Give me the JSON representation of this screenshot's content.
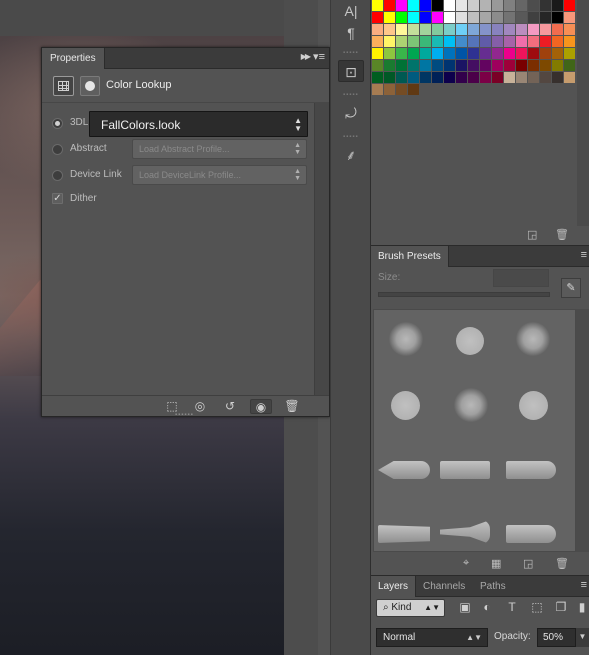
{
  "properties": {
    "tab_label": "Properties",
    "panel_title": "Color Lookup",
    "rows": [
      {
        "label": "3DLUT File",
        "value": "FallColors.look",
        "selected": true
      },
      {
        "label": "Abstract",
        "value": "Load Abstract Profile...",
        "selected": false
      },
      {
        "label": "Device Link",
        "value": "Load DeviceLink Profile...",
        "selected": false
      }
    ],
    "dither": {
      "label": "Dither",
      "checked": true
    }
  },
  "swatches": {
    "colors": [
      "#ffff00",
      "#ff0000",
      "#ff00ff",
      "#00ffff",
      "#0000ff",
      "#000000",
      "#ffffff",
      "#e6e6e6",
      "#cccccc",
      "#b3b3b3",
      "#999999",
      "#808080",
      "#666666",
      "#4d4d4d",
      "#333333",
      "#1a1a1a",
      "#ff0000",
      "#ff0000",
      "#ffff00",
      "#00ff00",
      "#00ffff",
      "#0000ff",
      "#ff00ff",
      "#ffffff",
      "#e0e0e0",
      "#bfbfbf",
      "#a6a6a6",
      "#8c8c8c",
      "#737373",
      "#595959",
      "#404040",
      "#262626",
      "#000000",
      "#f7977a",
      "#f9ad81",
      "#fdc68a",
      "#fff79a",
      "#c4df9b",
      "#a2d39c",
      "#82ca9d",
      "#7bcdc8",
      "#6ecff6",
      "#7ea7d8",
      "#8493ca",
      "#8882be",
      "#a187be",
      "#bc8dbf",
      "#f49ac2",
      "#f6989d",
      "#f26c4f",
      "#f68e55",
      "#fbaf5c",
      "#fff467",
      "#acd372",
      "#7cc576",
      "#3bb878",
      "#1abbb4",
      "#00bff3",
      "#438ccb",
      "#5574b9",
      "#605ca8",
      "#855fa8",
      "#a763a8",
      "#f06eaa",
      "#f26d7d",
      "#ed1c24",
      "#f26522",
      "#f7941d",
      "#fff200",
      "#8dc63f",
      "#39b54a",
      "#00a651",
      "#00a99d",
      "#00aeef",
      "#0072bc",
      "#0054a6",
      "#2e3192",
      "#662d91",
      "#92278f",
      "#ec008c",
      "#ed145b",
      "#9e0b0f",
      "#a0410d",
      "#a36209",
      "#aba000",
      "#598527",
      "#1a7b30",
      "#007236",
      "#00746b",
      "#0076a3",
      "#004b80",
      "#003471",
      "#1b1464",
      "#440e62",
      "#630460",
      "#9e005d",
      "#9e0039",
      "#790000",
      "#7b2e00",
      "#7d4900",
      "#827b00",
      "#406618",
      "#005e20",
      "#005826",
      "#005952",
      "#005b7f",
      "#003663",
      "#002157",
      "#0d004c",
      "#32004b",
      "#4b0049",
      "#7b0046",
      "#7a0026",
      "#c7b299",
      "#998675",
      "#736357",
      "#534741",
      "#37302d",
      "#c69c6d",
      "#a67c52",
      "#8c6239",
      "#754c24",
      "#603913"
    ]
  },
  "brush_presets": {
    "tab_label": "Brush Presets",
    "size_label": "Size:"
  },
  "layers": {
    "tabs": [
      "Layers",
      "Channels",
      "Paths"
    ],
    "kind_label": "Kind",
    "blend_mode": "Normal",
    "opacity_label": "Opacity:",
    "opacity_value": "50%"
  }
}
